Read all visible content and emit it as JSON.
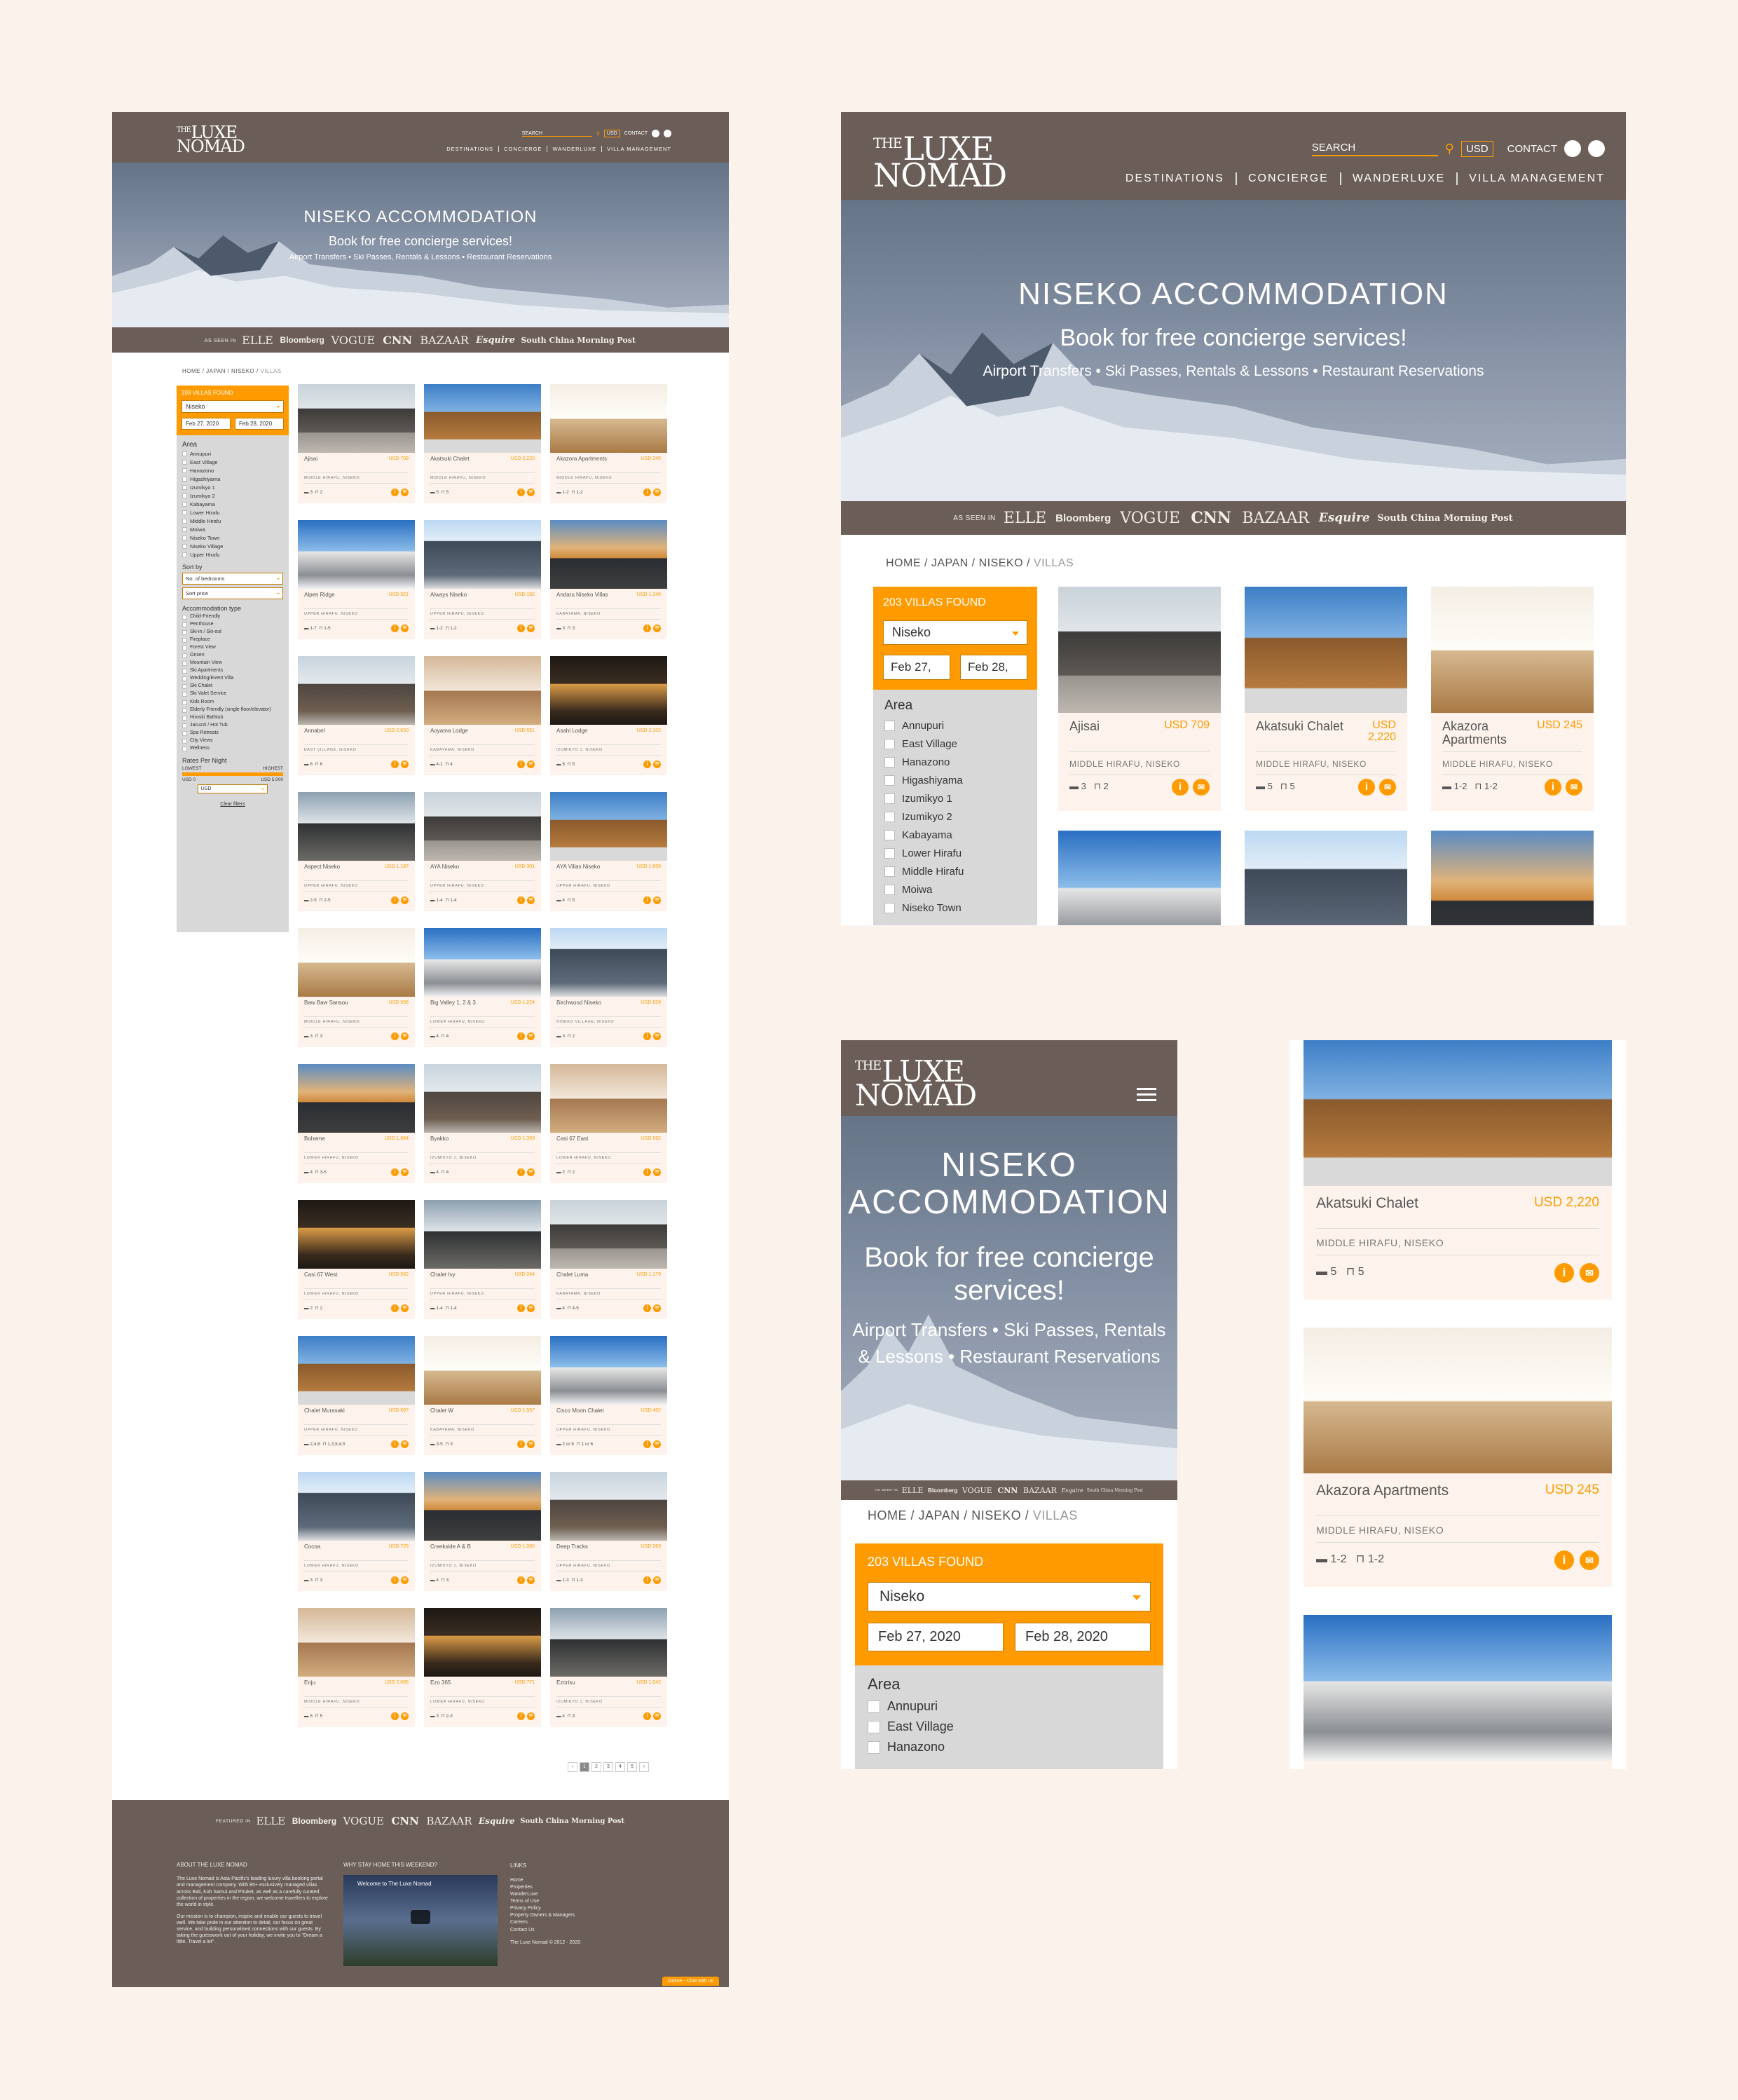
{
  "brand": {
    "logo_the": "THE",
    "logo_luxe": "LUXE",
    "logo_nomad": "NOMAD"
  },
  "header": {
    "search_label": "SEARCH",
    "currency": "USD",
    "contact": "CONTACT",
    "nav": [
      "DESTINATIONS",
      "CONCIERGE",
      "WANDERLUXE",
      "VILLA MANAGEMENT"
    ]
  },
  "hero": {
    "title": "NISEKO ACCOMMODATION",
    "subtitle": "Book for free concierge services!",
    "services": "Airport Transfers • Ski Passes, Rentals & Lessons • Restaurant Reservations"
  },
  "press": {
    "label": "AS SEEN IN",
    "footer_label": "FEATURED IN",
    "logos": [
      "ELLE",
      "Bloomberg",
      "VOGUE",
      "CNN",
      "BAZAAR",
      "Esquire",
      "South China Morning Post"
    ]
  },
  "breadcrumb": [
    "HOME",
    "JAPAN",
    "NISEKO",
    "VILLAS"
  ],
  "filter": {
    "found": "203 VILLAS FOUND",
    "location": "Niseko",
    "checkin": "Feb 27, 2020",
    "checkout": "Feb 28, 2020",
    "checkin_short": "Feb 27,",
    "checkout_short": "Feb 28,",
    "area_title": "Area",
    "areas": [
      "Annupuri",
      "East Village",
      "Hanazono",
      "Higashiyama",
      "Izumikyo 1",
      "Izumikyo 2",
      "Kabayama",
      "Lower Hirafu",
      "Middle Hirafu",
      "Moiwa",
      "Niseko Town",
      "Niseko Village",
      "Upper Hirafu"
    ],
    "sort_title": "Sort by",
    "sort_bedrooms": "No. of bedrooms",
    "sort_price": "Sort price",
    "type_title": "Accommodation type",
    "types": [
      "Child-Friendly",
      "Penthouse",
      "Ski-in / Ski-out",
      "Fireplace",
      "Forest View",
      "Onsen",
      "Mountain View",
      "Ski Apartments",
      "Wedding/Event Villa",
      "Ski Chalet",
      "Ski Valet Service",
      "Kids Room",
      "Elderly Friendly (single floor/elevator)",
      "Hiroski Bathtub",
      "Jacuzzi / Hot Tub",
      "Spa Retreats",
      "City Views",
      "Wellness"
    ],
    "rates_title": "Rates Per Night",
    "lowest": "LOWEST",
    "highest": "HIGHEST",
    "min": "USD 0",
    "max": "USD 5,000",
    "currency": "USD",
    "clear": "Clear filters"
  },
  "villas": [
    {
      "name": "Ajisai",
      "price": "USD 709",
      "loc": "MIDDLE HIRAFU, NISEKO",
      "beds": "3",
      "baths": "2"
    },
    {
      "name": "Akatsuki Chalet",
      "price": "USD 2,220",
      "loc": "MIDDLE HIRAFU, NISEKO",
      "beds": "5",
      "baths": "5"
    },
    {
      "name": "Akazora Apartments",
      "price": "USD 245",
      "loc": "MIDDLE HIRAFU, NISEKO",
      "beds": "1-2",
      "baths": "1-2"
    },
    {
      "name": "Alpen Ridge",
      "price": "USD 521",
      "loc": "UPPER HIRAFU, NISEKO",
      "beds": "1-7",
      "baths": "1-5"
    },
    {
      "name": "Always Niseko",
      "price": "USD 182",
      "loc": "UPPER HIRAFU, NISEKO",
      "beds": "1-2",
      "baths": "1-2"
    },
    {
      "name": "Andaru Niseko Villas",
      "price": "USD 1,346",
      "loc": "KABAYAMA, NISEKO",
      "beds": "3",
      "baths": "3"
    },
    {
      "name": "Annabel",
      "price": "USD 2,650",
      "loc": "EAST VILLAGE, NISEKO",
      "beds": "6",
      "baths": "6"
    },
    {
      "name": "Aoyama Lodge",
      "price": "USD 551",
      "loc": "KABAYAMA, NISEKO",
      "beds": "4-1",
      "baths": "4"
    },
    {
      "name": "Asahi Lodge",
      "price": "USD 2,102",
      "loc": "IZUMIKYO 1, NISEKO",
      "beds": "5",
      "baths": "5"
    },
    {
      "name": "Aspect Niseko",
      "price": "USD 1,187",
      "loc": "UPPER HIRAFU, NISEKO",
      "beds": "2-5",
      "baths": "2-5"
    },
    {
      "name": "AYA Niseko",
      "price": "USD 301",
      "loc": "UPPER HIRAFU, NISEKO",
      "beds": "1-4",
      "baths": "1-4"
    },
    {
      "name": "AYA Villas Niseko",
      "price": "USD 1,899",
      "loc": "UPPER HIRAFU, NISEKO",
      "beds": "4",
      "baths": "5"
    },
    {
      "name": "Baw Baw Sansou",
      "price": "USD 596",
      "loc": "MIDDLE HIRAFU, NISEKO",
      "beds": "3",
      "baths": "3"
    },
    {
      "name": "Big Valley 1, 2 & 3",
      "price": "USD 1,224",
      "loc": "LOWER HIRAFU, NISEKO",
      "beds": "4",
      "baths": "4"
    },
    {
      "name": "Birchwood Niseko",
      "price": "USD 829",
      "loc": "NISEKO VILLAGE, NISEKO",
      "beds": "3",
      "baths": "2"
    },
    {
      "name": "Boheme",
      "price": "USD 1,884",
      "loc": "LOWER HIRAFU, NISEKO",
      "beds": "4",
      "baths": "3-5"
    },
    {
      "name": "Byakko",
      "price": "USD 1,359",
      "loc": "IZUMIKYO 1, NISEKO",
      "beds": "4",
      "baths": "4"
    },
    {
      "name": "Casi 67 East",
      "price": "USD 562",
      "loc": "LOWER HIRAFU, NISEKO",
      "beds": "2",
      "baths": "2"
    },
    {
      "name": "Casi 67 West",
      "price": "USD 562",
      "loc": "LOWER HIRAFU, NISEKO",
      "beds": "2",
      "baths": "2"
    },
    {
      "name": "Chalet Ivy",
      "price": "USD 244",
      "loc": "UPPER HIRAFU, NISEKO",
      "beds": "1-4",
      "baths": "1-4"
    },
    {
      "name": "Chalet Luma",
      "price": "USD 1,179",
      "loc": "KABAYAMA, NISEKO",
      "beds": "4",
      "baths": "4-5"
    },
    {
      "name": "Chalet Murasaki",
      "price": "USD 607",
      "loc": "UPPER HIRAFU, NISEKO",
      "beds": "2,4,6",
      "baths": "1,3,5,4,5"
    },
    {
      "name": "Chalet W",
      "price": "USD 1,557",
      "loc": "KABAYAMA, NISEKO",
      "beds": "3-5",
      "baths": "3"
    },
    {
      "name": "Cisco Moon Chalet",
      "price": "USD 452",
      "loc": "UPPER HIRAFU, NISEKO",
      "beds": "2 or 6",
      "baths": "1 or 6"
    },
    {
      "name": "Cocoa",
      "price": "USD 725",
      "loc": "LOWER HIRAFU, NISEKO",
      "beds": "3",
      "baths": "3"
    },
    {
      "name": "Creekside A & B",
      "price": "USD 1,065",
      "loc": "IZUMIKYO 1, NISEKO",
      "beds": "4",
      "baths": "3"
    },
    {
      "name": "Deep Tracks",
      "price": "USD 363",
      "loc": "UPPER HIRAFU, NISEKO",
      "beds": "1-3",
      "baths": "1-3"
    },
    {
      "name": "Enju",
      "price": "USD 2,066",
      "loc": "MIDDLE HIRAFU, NISEKO",
      "beds": "5",
      "baths": "5"
    },
    {
      "name": "Ezo 365",
      "price": "USD 771",
      "loc": "LOWER HIRAFU, NISEKO",
      "beds": "3",
      "baths": "2-3"
    },
    {
      "name": "Ezorisu",
      "price": "USD 1,042",
      "loc": "IZUMIKYO 1, NISEKO",
      "beds": "4",
      "baths": "3"
    }
  ],
  "pagination": [
    "‹",
    "1",
    "2",
    "3",
    "4",
    "5",
    "›"
  ],
  "footer": {
    "about_title": "ABOUT THE LUXE NOMAD",
    "about_text": "The Luxe Nomad is Asia-Pacific's leading luxury villa booking portal and management company. With 85+ exclusively managed villas across Bali, Koh Samui and Phuket, as well as a carefully curated collection of properties in the region, we welcome travellers to explore the world in style.",
    "mission_text": "Our mission is to champion, inspire and enable our guests to travel well. We take pride in our attention to detail, our focus on great service, and building personalised connections with our guests. By taking the guesswork out of your holiday, we invite you to \"Dream a little. Travel a lot\".",
    "video_title": "WHY STAY HOME THIS WEEKEND?",
    "video_caption": "Welcome to The Luxe Nomad",
    "links_title": "LINKS",
    "links": [
      "Home",
      "Properties",
      "WanderLuxe",
      "Terms of Use",
      "Privacy Policy",
      "Property Owners & Managers",
      "Careers",
      "Contact Us"
    ],
    "copyright": "The Luxe Nomad © 2012 - 2020",
    "chat": "Online - Chat with us"
  },
  "mobile": {
    "filter_areas": [
      "Annupuri",
      "East Village",
      "Hanazono"
    ]
  },
  "colors": {
    "brown": "#6b5e58",
    "orange": "#ff9b00",
    "cream": "#fdf3ec",
    "bg": "#fcf2ec"
  }
}
